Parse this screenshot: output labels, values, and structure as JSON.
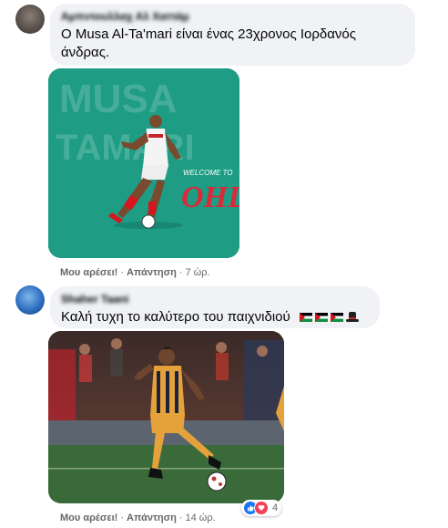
{
  "comments": [
    {
      "author": "Αμπντουλλαχ Αλ Χαττάμ",
      "text_line1": "Ο Musa Al-Ta'mari είναι ένας 23χρονος Ιορδανός",
      "text_line2": "άνδρας.",
      "image": {
        "background_color": "#1e9c84",
        "watermark_text": "MUSA TAMARI",
        "welcome_text": "WELCOME TO",
        "club_text": "OHL"
      },
      "actions": {
        "like": "Μου αρέσει!",
        "reply": "Απάντηση",
        "time": "7 ώρ."
      }
    },
    {
      "author": "Shaher Taani",
      "text": "Καλή τυχη το καλύτερο του παιχνιδιού",
      "emoji": [
        "palestine-flag-icon",
        "palestine-flag-icon",
        "palestine-flag-icon",
        "top-hat-icon"
      ],
      "image": {
        "pitch_color": "#3a6a3a",
        "kit_colors": [
          "#e6a23a",
          "#1b2340"
        ]
      },
      "actions": {
        "like": "Μου αρέσει!",
        "reply": "Απάντηση",
        "time": "14 ώρ."
      },
      "reactions": {
        "icons": [
          "like-icon",
          "love-icon"
        ],
        "count": "4"
      }
    }
  ],
  "separator": "·"
}
